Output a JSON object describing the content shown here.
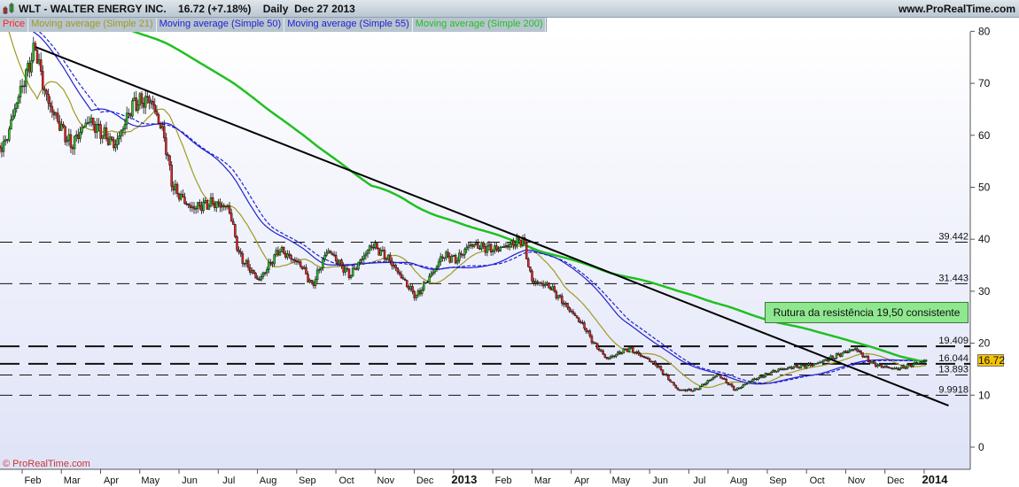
{
  "header": {
    "title": "WLT - WALTER ENERGY INC.",
    "price": "16.72 (+7.18%)",
    "period": "Daily",
    "date": "Dec 27 2013",
    "site": "www.ProRealTime.com"
  },
  "legend": [
    {
      "label": "Price",
      "color": "#ff2020"
    },
    {
      "label": "Moving average (Simple 21)",
      "color": "#a09a20"
    },
    {
      "label": "Moving average (Simple 50)",
      "color": "#2020d0"
    },
    {
      "label": "Moving average (Simple 55)",
      "color": "#2020d0"
    },
    {
      "label": "Moving average (Simple 200)",
      "color": "#20c020"
    }
  ],
  "copyright": "© ProRealTime.com",
  "annotation": "Rutura da resistência 19,50 consistente",
  "last_price_tag": "16.72",
  "chart_data": {
    "type": "candlestick",
    "title": "WLT - WALTER ENERGY INC. Daily",
    "x_unit": "months since 2012-02-01",
    "ylim": [
      -2,
      82
    ],
    "yticks": [
      0,
      10,
      20,
      30,
      40,
      50,
      60,
      70,
      80
    ],
    "xticks": [
      {
        "t": 0,
        "label": "Feb"
      },
      {
        "t": 1,
        "label": "Mar"
      },
      {
        "t": 2,
        "label": "Apr"
      },
      {
        "t": 3,
        "label": "May"
      },
      {
        "t": 4,
        "label": "Jun"
      },
      {
        "t": 5,
        "label": "Jul"
      },
      {
        "t": 6,
        "label": "Aug"
      },
      {
        "t": 7,
        "label": "Sep"
      },
      {
        "t": 8,
        "label": "Oct"
      },
      {
        "t": 9,
        "label": "Nov"
      },
      {
        "t": 10,
        "label": "Dec"
      },
      {
        "t": 11,
        "label": "2013",
        "bold": true
      },
      {
        "t": 12,
        "label": "Feb"
      },
      {
        "t": 13,
        "label": "Mar"
      },
      {
        "t": 14,
        "label": "Apr"
      },
      {
        "t": 15,
        "label": "May"
      },
      {
        "t": 16,
        "label": "Jun"
      },
      {
        "t": 17,
        "label": "Jul"
      },
      {
        "t": 18,
        "label": "Aug"
      },
      {
        "t": 19,
        "label": "Sep"
      },
      {
        "t": 20,
        "label": "Oct"
      },
      {
        "t": 21,
        "label": "Nov"
      },
      {
        "t": 22,
        "label": "Dec"
      },
      {
        "t": 23,
        "label": "2014",
        "bold": true
      }
    ],
    "price_path": [
      [
        -0.84,
        58
      ],
      [
        -0.72,
        58
      ],
      [
        -0.39,
        67
      ],
      [
        0.07,
        77
      ],
      [
        0.25,
        70
      ],
      [
        0.41,
        66
      ],
      [
        0.97,
        58
      ],
      [
        1.42,
        63
      ],
      [
        2.1,
        58
      ],
      [
        2.55,
        66
      ],
      [
        3.0,
        67
      ],
      [
        3.34,
        60
      ],
      [
        3.57,
        50
      ],
      [
        4.02,
        46
      ],
      [
        4.59,
        47
      ],
      [
        5.0,
        46
      ],
      [
        5.26,
        37
      ],
      [
        5.76,
        32
      ],
      [
        6.28,
        38
      ],
      [
        6.85,
        35
      ],
      [
        7.12,
        31
      ],
      [
        7.52,
        38
      ],
      [
        8.09,
        33
      ],
      [
        8.65,
        39
      ],
      [
        9.1,
        36
      ],
      [
        9.56,
        31
      ],
      [
        9.78,
        29
      ],
      [
        10.23,
        34
      ],
      [
        10.46,
        37
      ],
      [
        10.8,
        36
      ],
      [
        11.14,
        39
      ],
      [
        11.82,
        38
      ],
      [
        12.5,
        40
      ],
      [
        12.72,
        32
      ],
      [
        13.17,
        31
      ],
      [
        13.62,
        27
      ],
      [
        14.08,
        23
      ],
      [
        14.3,
        20
      ],
      [
        14.64,
        17
      ],
      [
        15.2,
        19
      ],
      [
        15.88,
        16
      ],
      [
        16.45,
        11
      ],
      [
        16.9,
        11
      ],
      [
        17.46,
        14
      ],
      [
        17.92,
        11
      ],
      [
        18.37,
        13
      ],
      [
        19.05,
        15
      ],
      [
        19.95,
        16
      ],
      [
        20.97,
        19
      ],
      [
        21.42,
        16
      ],
      [
        21.99,
        15
      ],
      [
        22.8,
        16.72
      ]
    ],
    "pre_history_level": 92,
    "series": [
      {
        "name": "Moving average (Simple 21)",
        "period": 21,
        "color": "#a09a20"
      },
      {
        "name": "Moving average (Simple 50)",
        "period": 50,
        "color": "#2020d0"
      },
      {
        "name": "Moving average (Simple 55)",
        "period": 55,
        "color": "#2020d0",
        "dashed": true
      },
      {
        "name": "Moving average (Simple 200)",
        "period": 200,
        "color": "#20c020"
      }
    ],
    "trendline": {
      "start": [
        0.07,
        77
      ],
      "end": [
        23.35,
        8
      ]
    },
    "levels": [
      {
        "value": 39.442,
        "label": "39.442"
      },
      {
        "value": 31.443,
        "label": "31.443"
      },
      {
        "value": 19.409,
        "label": "19.409",
        "bold": true
      },
      {
        "value": 16.044,
        "label": "16.044",
        "bold": true
      },
      {
        "value": 13.893,
        "label": "13.893"
      },
      {
        "value": 9.9918,
        "label": "9.9918"
      }
    ],
    "last": 16.72
  }
}
